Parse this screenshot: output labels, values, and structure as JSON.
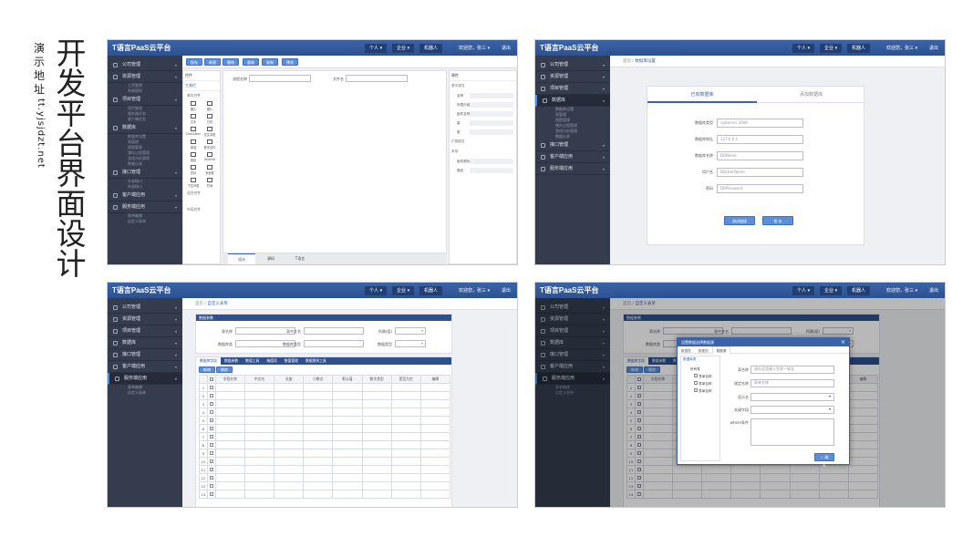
{
  "page": {
    "title": "开发平台界面设计",
    "subtitle": "演示地址",
    "url": "tt.yjsjdzt.net"
  },
  "app": {
    "brand": "T语言PaaS云平台",
    "nav": [
      "个人 ▾",
      "企业 ▾",
      "机器人"
    ],
    "user": "欢迎您，张三 ▾",
    "logout": "退出"
  },
  "sidebar": {
    "items": [
      {
        "label": "公司管理",
        "subs": []
      },
      {
        "label": "资源管理",
        "subs": [
          "工资管理",
          "系统理财"
        ]
      },
      {
        "label": "项目管理",
        "subs": [
          "项目管理",
          "服务器任务",
          "客户端任务"
        ]
      },
      {
        "label": "数据库",
        "subs": [
          "数据库设置",
          "表管理",
          "视图管理",
          "储存过程管理",
          "游戏分析管理",
          "数据仪表"
        ]
      },
      {
        "label": "接口管理",
        "subs": [
          "外部接口",
          "外部接口"
        ]
      },
      {
        "label": "客户端应用",
        "subs": []
      },
      {
        "label": "服务端应用",
        "subs": [
          "表单编辑",
          "自定义表单"
        ]
      }
    ]
  },
  "panel1": {
    "toolbar": [
      "保存",
      "新建",
      "撤销",
      "重做",
      "复制",
      "预览"
    ],
    "palette_head": "控件",
    "palette_sub": "工具栏",
    "group1": "基本控件",
    "group2": "组合控件",
    "group3": "布局控件",
    "widgets": [
      "图片",
      "图片",
      "文本",
      "日历",
      "CheckBox",
      "富文本框",
      "单选",
      "数字控件",
      "按钮",
      "TextEdit",
      "形状",
      "多选框",
      "下拉列表",
      "时间"
    ],
    "form_label_1": "流程名称",
    "form_label_2": "文件名",
    "tabs": [
      "设计",
      "源码",
      "T语言"
    ],
    "props_head": "属性",
    "props": [
      "基本属性",
      "名称",
      "所属分组",
      "组件名称",
      "高",
      "宽",
      "扩展属性",
      "其他",
      "组件图标",
      "路径"
    ]
  },
  "panel2": {
    "crumb_home": "首页",
    "crumb_cur": "数据库设置",
    "tab_active": "已有数据库",
    "tab_other": "添加数据库",
    "fields": [
      {
        "label": "数据库类型",
        "value": "sqlserver 2008"
      },
      {
        "label": "数据库地址",
        "value": "127.0.0.1"
      },
      {
        "label": "数据库名称",
        "value": "DBName"
      },
      {
        "label": "用户名",
        "value": "DBUserName"
      },
      {
        "label": "密码",
        "value": "DBPassword"
      }
    ],
    "btn_test": "测试链接",
    "btn_save": "保 存"
  },
  "panel3": {
    "crumb_home": "首页",
    "crumb_cur": "自定义表单",
    "section": "数据参数",
    "labels": [
      "表名称",
      "表中文名",
      "所属(组)",
      "数据库类",
      "数据库类型",
      "数据类型",
      "表体数据"
    ],
    "grid_tabs": [
      "数据库字段",
      "数据参数",
      "数值工具",
      "格值项",
      "数值管理",
      "数据规则工具"
    ],
    "grid_btns": [
      "新增",
      "删除"
    ],
    "columns": [
      "",
      "",
      "字段名称",
      "中文名",
      "长度",
      "小数点",
      "默认值",
      "数字类型",
      "是否为空",
      "编辑"
    ],
    "rows": [
      "1",
      "2",
      "3",
      "4",
      "5",
      "6",
      "7",
      "8",
      "9",
      "10",
      "11",
      "12",
      "13",
      "14"
    ]
  },
  "panel4": {
    "dialog_title": "设置数据选择数据源",
    "dialog_tabs": [
      "数据表",
      "数据视",
      "数据源"
    ],
    "tree_head": "数据库表",
    "tree_root": "所有表",
    "tree": [
      "表单名称",
      "表单名称",
      "表单名称"
    ],
    "labels": [
      "表名称",
      "规定名称",
      "显示名",
      "关键字段",
      "where条件"
    ],
    "values": [
      "请在这里输入名称一致名",
      "表单名称",
      "",
      "",
      ""
    ],
    "ok": "确定"
  }
}
